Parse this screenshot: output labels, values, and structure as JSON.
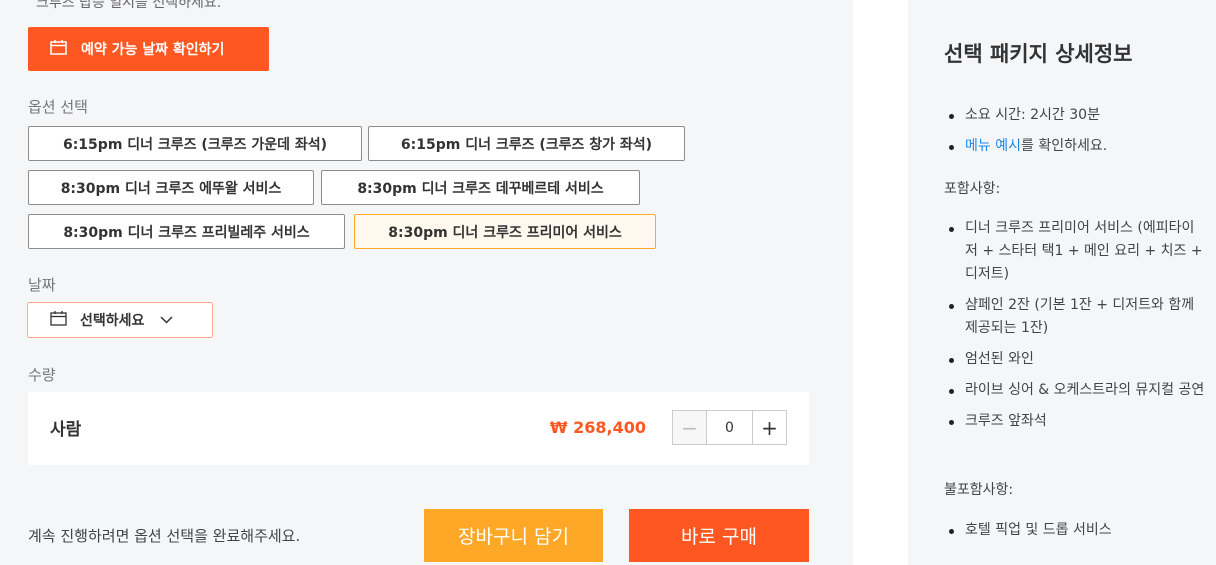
{
  "booking": {
    "top_note": "크루즈 탑승 일시를 선택하세요.",
    "availability_button": "예약 가능 날짜 확인하기",
    "option_label": "옵션 선택",
    "options": [
      {
        "label": "6:15pm 디너 크루즈 (크루즈 가운데 좌석)",
        "selected": false
      },
      {
        "label": "6:15pm 디너 크루즈 (크루즈 창가 좌석)",
        "selected": false
      },
      {
        "label": "8:30pm 디너 크루즈 에뚜왈 서비스",
        "selected": false
      },
      {
        "label": "8:30pm 디너 크루즈 데꾸베르테 서비스",
        "selected": false
      },
      {
        "label": "8:30pm 디너 크루즈 프리빌레주 서비스",
        "selected": false
      },
      {
        "label": "8:30pm 디너 크루즈 프리미어 서비스",
        "selected": true
      }
    ],
    "date_label": "날짜",
    "date_placeholder": "선택하세요",
    "quantity_label": "수량",
    "quantity": {
      "name": "사람",
      "price": "₩ 268,400",
      "value": "0",
      "minus": "−",
      "plus": "+"
    },
    "bottom_note": "계속 진행하려면 옵션 선택을 완료해주세요.",
    "cart_button": "장바구니 담기",
    "buy_button": "바로 구매"
  },
  "details": {
    "title": "선택 패키지 상세정보",
    "info": {
      "duration": "소요 시간: 2시간 30분",
      "menu_link": "메뉴 예시",
      "menu_suffix": "를 확인하세요."
    },
    "included_label": "포함사항:",
    "included": [
      "디너 크루즈 프리미어 서비스 (에피타이저 + 스타터 택1 + 메인 요리 + 치즈 + 디저트)",
      "샴페인 2잔 (기본 1잔 + 디저트와 함께 제공되는 1잔)",
      "엄선된 와인",
      "라이브 싱어 & 오케스트라의 뮤지컬 공연",
      "크루즈 앞좌석"
    ],
    "excluded_label": "불포함사항:",
    "excluded": [
      "호텔 픽업 및 드롭 서비스"
    ]
  },
  "colors": {
    "primary": "#ff5722",
    "secondary": "#ffa726",
    "link": "#1e88e5",
    "panel_bg": "#f5f6f8"
  }
}
